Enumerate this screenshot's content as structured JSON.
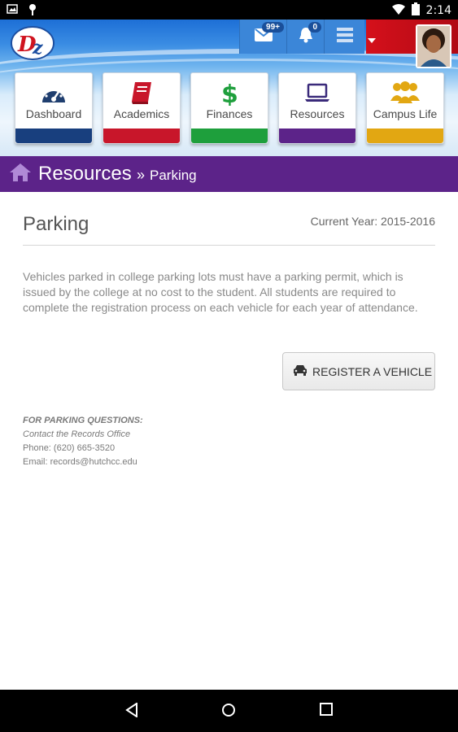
{
  "status_bar": {
    "time": "2:14"
  },
  "header": {
    "mail_badge": "99+",
    "notification_badge": "0"
  },
  "tiles": [
    {
      "label": "Dashboard",
      "color": "#183f7e",
      "icon_color": "#1f3e6f",
      "icon": "gauge-icon"
    },
    {
      "label": "Academics",
      "color": "#c8162a",
      "icon_color": "#c8162a",
      "icon": "book-icon"
    },
    {
      "label": "Finances",
      "color": "#1e9f3c",
      "icon_color": "#1e9f3c",
      "icon": "dollar-icon"
    },
    {
      "label": "Resources",
      "color": "#5c2389",
      "icon_color": "#3a2a7a",
      "icon": "laptop-icon"
    },
    {
      "label": "Campus Life",
      "color": "#e2a712",
      "icon_color": "#e2a712",
      "icon": "people-icon"
    }
  ],
  "breadcrumb": {
    "section": "Resources",
    "separator": "»",
    "page": "Parking"
  },
  "page": {
    "title": "Parking",
    "current_year": "Current Year: 2015-2016",
    "description": "Vehicles parked in college parking lots must have a parking permit, which is issued by the college at no cost to the student. All students are required to complete the registration process on each vehicle for each year of attendance.",
    "register_button": "REGISTER A VEHICLE"
  },
  "contact": {
    "heading": "FOR PARKING QUESTIONS:",
    "office": "Contact the Records Office",
    "phone": "Phone: (620) 665-3520",
    "email": "Email: records@hutchcc.edu"
  }
}
